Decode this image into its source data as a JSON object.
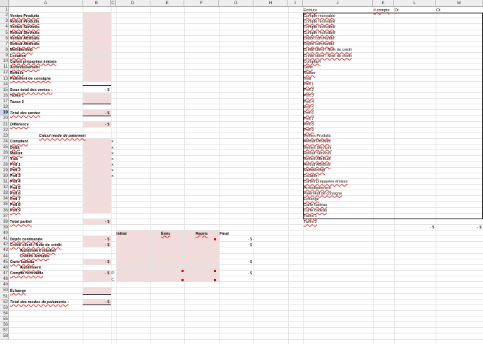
{
  "columns": [
    "A",
    "B",
    "C",
    "D",
    "E",
    "F",
    "G",
    "H",
    "I",
    "J",
    "K",
    "L",
    "M"
  ],
  "rows": [
    "1",
    "2",
    "3",
    "4",
    "5",
    "6",
    "7",
    "8",
    "9",
    "10",
    "11",
    "12",
    "13",
    "14",
    "15",
    "16",
    "17",
    "18",
    "19",
    "20",
    "21",
    "22",
    "23",
    "24",
    "25",
    "26",
    "27",
    "28",
    "29",
    "30",
    "31",
    "32",
    "33",
    "34",
    "35",
    "36",
    "37",
    "38",
    "39",
    "40",
    "41",
    "42",
    "43",
    "44",
    "45",
    "46",
    "47",
    "48",
    "49",
    "50",
    "51",
    "52",
    "53",
    "54",
    "55",
    "56",
    "57",
    "58"
  ],
  "selected_row": "19",
  "sales": {
    "items": [
      "Ventes Produits",
      "Retour Produits",
      "Ventes Services",
      "Retour Services",
      "Ventes Attributs",
      "Retour Attributs",
      "Membership",
      "Location",
      "Cartes prépayées émises",
      "Arrondissement",
      "Remise",
      "Paiement de  consigne"
    ],
    "subtotal_label": "Sous-total des ventes :",
    "subtotal_value": "-  $",
    "tax1": "Taxes 1",
    "tax2": "Taxes 2",
    "total_label": "Total des ventes",
    "total_value": "-  $",
    "difference_label": "Différence",
    "difference_value": "-  $"
  },
  "payment": {
    "title": "Calcul mode de paiement",
    "items": [
      "Comptant",
      "Débit",
      "Master",
      "Visa",
      "Pmt 1",
      "Pmt 2",
      "Pmt 3",
      "Pmt 4",
      "Pmt 5",
      "Pmt 6",
      "Pmt 7",
      "Pmt 8",
      "Pmt 9"
    ],
    "x_marks": [
      "x",
      "x",
      "x",
      "x",
      "x",
      "x",
      "x"
    ],
    "partial_label": "Total partiel",
    "partial_value": "-  $"
  },
  "accounts": {
    "headers": {
      "initial": "Initial",
      "emis": "Émis",
      "repris": "Repris",
      "final": "Final"
    },
    "deposit": "Dépôt commande",
    "deposit_value": "-  $",
    "deposit_final": "-  $",
    "credit": "Crédit client / Note de crédit",
    "credit_value": "-  $",
    "credit_final": "-  $",
    "adjust_manual": "Ajustement manuel",
    "credits_annual": "Crédits Annulés",
    "gift_card": "Carte cadeau",
    "gift_value": "-  $",
    "gift_final": "-  $",
    "adjust": "Ajustement",
    "receivable": "Compte recevable",
    "receivable_value": "-  $",
    "receivable_c1": "P",
    "receivable_c2": "C",
    "receivable_final": "-  $",
    "exchange": "Échange",
    "total_label": "Total des modes de paiements :",
    "total_value": "-  $"
  },
  "journal": {
    "headers": {
      "ecriture": "Écriture",
      "compte": "# compte",
      "dt": "Dt",
      "ct": "Ct"
    },
    "rows": [
      "Compte recevable",
      "Compte recevable",
      "Compte recevable",
      "Compte recevable",
      "Dépôt commande",
      "Dépôt commande",
      "Crédit client / Note de crédit",
      "Crédit client / Note de crédit",
      "Comptant",
      "Débit",
      "Master",
      "Visa",
      "Pmt 1",
      "Pmt 2",
      "Pmt 3",
      "Pmt 4",
      "Pmt 5",
      "Pmt 6",
      "Pmt 7",
      "Pmt 8",
      "Pmt 9",
      "Ventes Produits",
      "Retour Produits",
      "Ventes Services",
      "Retour Services",
      "Ventes Attributs",
      "Retour Attributs",
      "Membership",
      "Location",
      "Cartes prépayées émises",
      "Arrondissement",
      "Paiement de  consigne",
      "Échange",
      "Carte cadeau",
      "Carte cadeau",
      "Taxes 1",
      "Taxes 2"
    ],
    "total_dt": "-  $",
    "total_ct": "-  $"
  }
}
